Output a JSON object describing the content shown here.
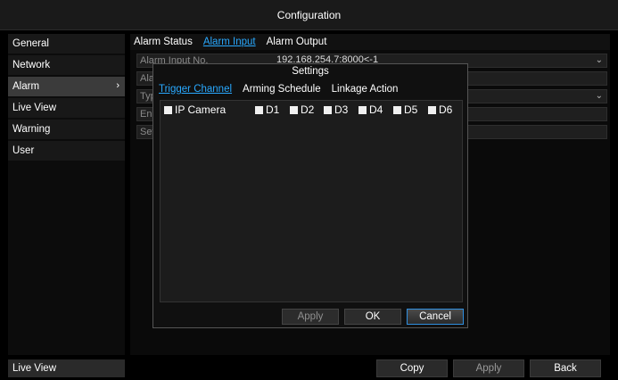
{
  "window": {
    "title": "Configuration"
  },
  "sidebar": {
    "items": [
      {
        "label": "General"
      },
      {
        "label": "Network"
      },
      {
        "label": "Alarm",
        "chevron": "›"
      },
      {
        "label": "Live View"
      },
      {
        "label": "Warning"
      },
      {
        "label": "User"
      }
    ],
    "bottom_label": "Live View"
  },
  "main": {
    "tabs": [
      "Alarm Status",
      "Alarm Input",
      "Alarm Output"
    ],
    "rows": [
      {
        "label": "Alarm Input No.",
        "value": "192.168.254.7:8000<-1"
      },
      {
        "label": "Ala"
      },
      {
        "label": "Typ"
      },
      {
        "label": "Ena"
      },
      {
        "label": "Set"
      }
    ]
  },
  "footer": {
    "copy": "Copy",
    "apply": "Apply",
    "back": "Back"
  },
  "dialog": {
    "title": "Settings",
    "tabs": [
      "Trigger Channel",
      "Arming Schedule",
      "Linkage Action"
    ],
    "group_label": "IP Camera",
    "channels": [
      "D1",
      "D2",
      "D3",
      "D4",
      "D5",
      "D6"
    ],
    "buttons": {
      "apply": "Apply",
      "ok": "OK",
      "cancel": "Cancel"
    }
  },
  "colors": {
    "accent": "#29a9ff",
    "background": "#000000",
    "panel": "#1c1c1c"
  }
}
